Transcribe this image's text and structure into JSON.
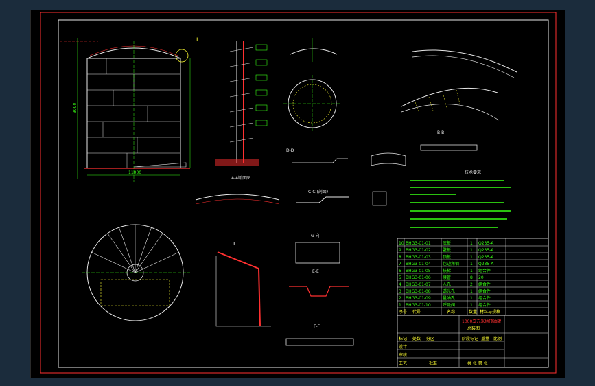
{
  "sheet": {
    "detail_markers": [
      "II",
      "A-A断面图",
      "B-B断面图",
      "C-C (剖面)",
      "G 向",
      "E-E",
      "F-F",
      "B-B",
      "D-D"
    ],
    "dims": {
      "height_left": "3000",
      "base_width": "11000",
      "dome_top": "1200"
    }
  },
  "parts_table": {
    "rows": [
      {
        "code": "BHG3-01-01",
        "name": "底板",
        "qty": "1",
        "material": "Q235-A"
      },
      {
        "code": "BHG3-01-02",
        "name": "壁板",
        "qty": "1",
        "material": "Q235-A"
      },
      {
        "code": "BHG3-01-03",
        "name": "顶板",
        "qty": "1",
        "material": "Q235-A"
      },
      {
        "code": "BHG3-01-04",
        "name": "包边角钢",
        "qty": "1",
        "material": "Q235-A"
      },
      {
        "code": "BHG3-01-05",
        "name": "扶梯",
        "qty": "1",
        "material": "组合件"
      },
      {
        "code": "BHG3-01-06",
        "name": "接管",
        "qty": "8",
        "material": "20"
      },
      {
        "code": "BHG3-01-07",
        "name": "人孔",
        "qty": "2",
        "material": "组合件"
      },
      {
        "code": "BHG3-01-08",
        "name": "透光孔",
        "qty": "1",
        "material": "组合件"
      },
      {
        "code": "BHG3-01-09",
        "name": "量油孔",
        "qty": "1",
        "material": "组合件"
      },
      {
        "code": "BHG3-01-10",
        "name": "呼吸阀",
        "qty": "1",
        "material": "组合件"
      }
    ],
    "header": [
      "序号",
      "代号",
      "名称",
      "数量",
      "材料与规格"
    ]
  },
  "title_block": {
    "project": "1000立方米拱顶油罐",
    "drawing_name": "总装图",
    "labels": [
      "标记",
      "处数",
      "分区",
      "更改文件号",
      "签名",
      "年月日"
    ],
    "approval": [
      "设计",
      "审核",
      "工艺",
      "批准"
    ],
    "stage": [
      "阶段标记",
      "重量",
      "比例"
    ],
    "sheet_info": "共 张 第 张"
  },
  "notes_title": "技术要求"
}
